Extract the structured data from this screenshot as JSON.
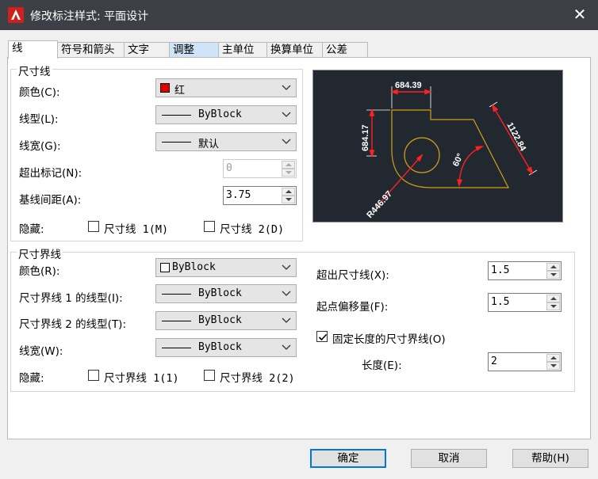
{
  "window": {
    "title": "修改标注样式: 平面设计",
    "close_glyph": "✕"
  },
  "tabs": [
    {
      "label": "线",
      "active": true
    },
    {
      "label": "符号和箭头"
    },
    {
      "label": "文字"
    },
    {
      "label": "调整"
    },
    {
      "label": "主单位"
    },
    {
      "label": "换算单位"
    },
    {
      "label": "公差"
    }
  ],
  "dim_line": {
    "legend": "尺寸线",
    "color_label": "颜色(C):",
    "color_value": "红",
    "color_swatch": "#e00000",
    "linetype_label": "线型(L):",
    "linetype_value": "ByBlock",
    "lineweight_label": "线宽(G):",
    "lineweight_value": "默认",
    "extend_ticks_label": "超出标记(N):",
    "extend_ticks_value": "0",
    "baseline_spacing_label": "基线间距(A):",
    "baseline_spacing_value": "3.75",
    "suppress_label": "隐藏:",
    "suppress_1": "尺寸线 1(M)",
    "suppress_2": "尺寸线 2(D)"
  },
  "ext_line": {
    "legend": "尺寸界线",
    "color_label": "颜色(R):",
    "color_value": "ByBlock",
    "linetype1_label": "尺寸界线 1 的线型(I):",
    "linetype1_value": "ByBlock",
    "linetype2_label": "尺寸界线 2 的线型(T):",
    "linetype2_value": "ByBlock",
    "lineweight_label": "线宽(W):",
    "lineweight_value": "ByBlock",
    "suppress_label": "隐藏:",
    "suppress_1": "尺寸界线 1(1)",
    "suppress_2": "尺寸界线 2(2)",
    "extend_beyond_label": "超出尺寸线(X):",
    "extend_beyond_value": "1.5",
    "offset_label": "起点偏移量(F):",
    "offset_value": "1.5",
    "fixed_length_label": "固定长度的尺寸界线(O)",
    "fixed_length_checked": true,
    "length_label": "长度(E):",
    "length_value": "2"
  },
  "preview": {
    "dim_top": "684.39",
    "dim_left": "684.17",
    "dim_right": "1122.84",
    "dim_angle": "60°",
    "dim_radius": "R446.97",
    "colors": {
      "background": "#212830",
      "geometry": "#d4a017",
      "dim_line": "#ff2020",
      "text": "#ffffff"
    }
  },
  "buttons": {
    "ok": "确定",
    "cancel": "取消",
    "help": "帮助(H)"
  }
}
